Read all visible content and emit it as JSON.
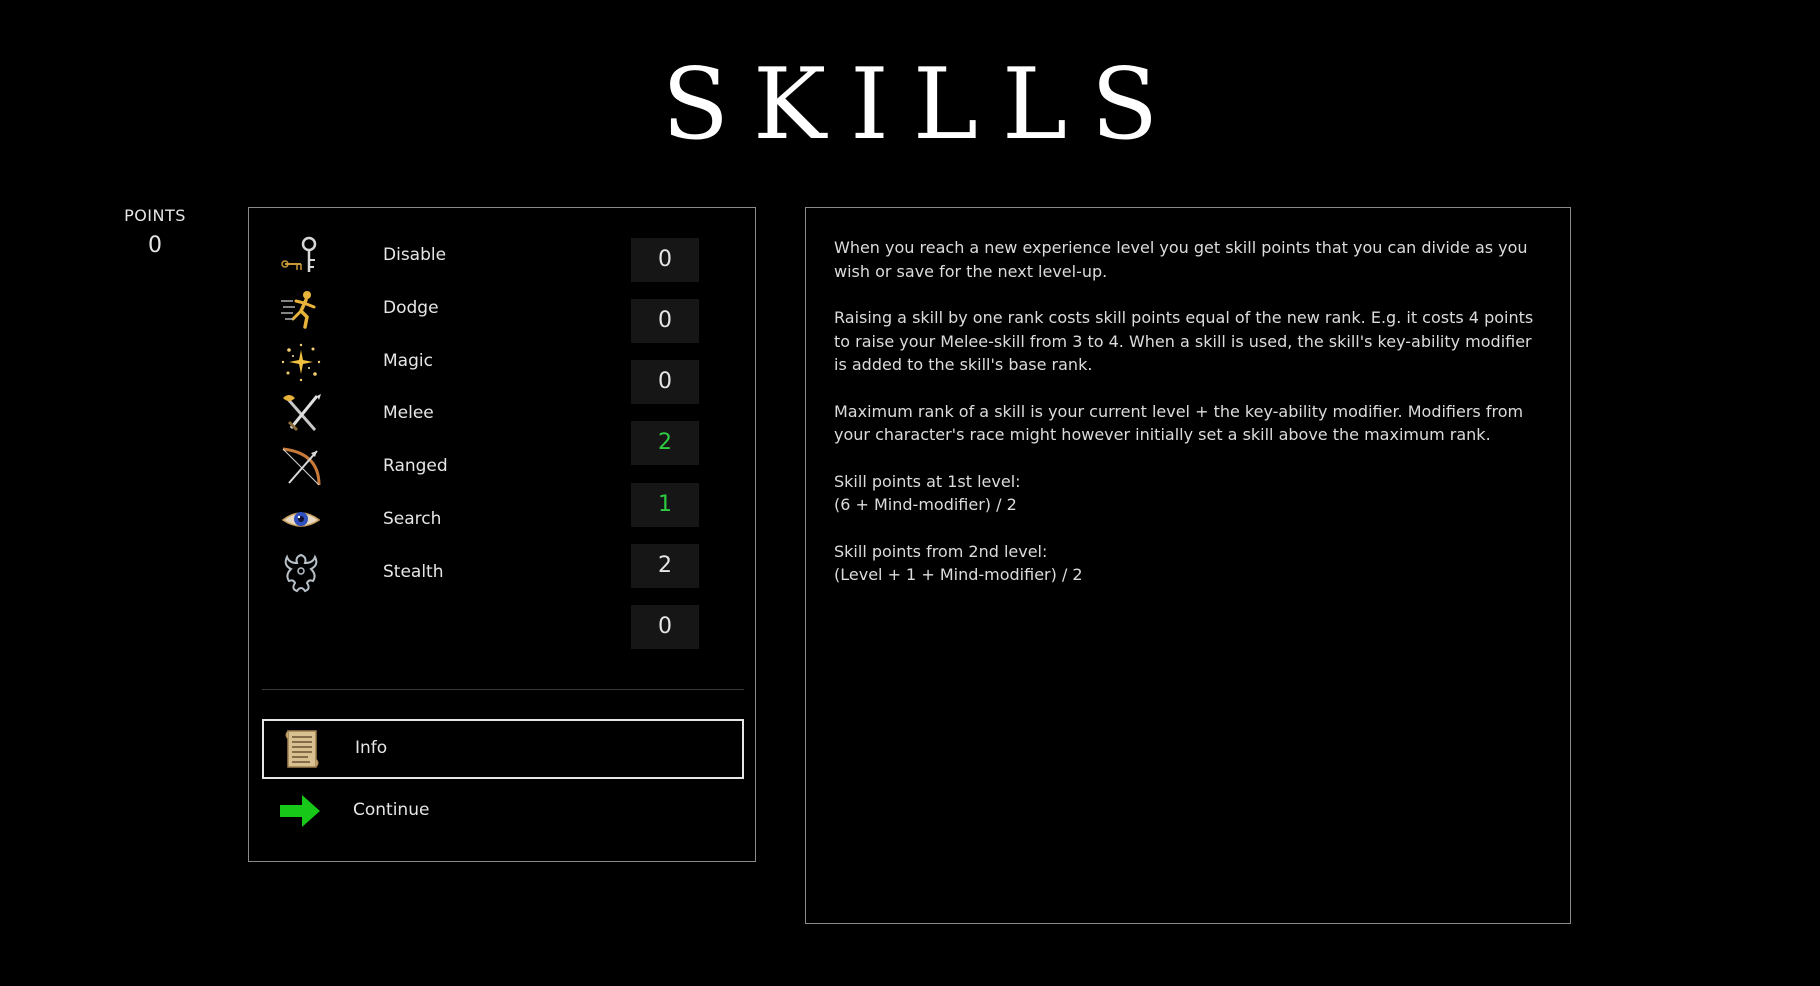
{
  "title": "SKILLS",
  "points": {
    "label": "POINTS",
    "value": "0"
  },
  "skills": [
    {
      "label": "Disable",
      "rank": "0",
      "icon": "disable-icon",
      "raised": false
    },
    {
      "label": "Dodge",
      "rank": "0",
      "icon": "dodge-icon",
      "raised": false
    },
    {
      "label": "Magic",
      "rank": "0",
      "icon": "magic-icon",
      "raised": false
    },
    {
      "label": "Melee",
      "rank": "2",
      "icon": "melee-icon",
      "raised": true
    },
    {
      "label": "Ranged",
      "rank": "1",
      "icon": "ranged-icon",
      "raised": true
    },
    {
      "label": "Search",
      "rank": "2",
      "icon": "search-icon",
      "raised": false
    },
    {
      "label": "Stealth",
      "rank": "0",
      "icon": "stealth-icon",
      "raised": false
    }
  ],
  "actions": {
    "info": {
      "label": "Info",
      "icon": "scroll-icon"
    },
    "continue": {
      "label": "Continue",
      "icon": "green-arrow-icon"
    }
  },
  "info_text": {
    "p1": "When you reach a new experience level you get skill points that you can divide as you wish or save for the next level-up.",
    "p2": "Raising a skill by one rank costs skill points equal of the new rank. E.g. it costs 4 points to raise your Melee-skill from 3 to 4. When a skill is used, the skill's key-ability modifier is added to the skill's base rank.",
    "p3": "Maximum rank of a skill is your current level + the key-ability modifier. Modifiers from your character's race might however initially set a skill above the maximum rank.",
    "p4_line1": "Skill points at 1st level:",
    "p4_line2": "(6 + Mind-modifier) / 2",
    "p5_line1": "Skill points from 2nd level:",
    "p5_line2": "(Level + 1 + Mind-modifier) / 2"
  },
  "colors": {
    "background": "#000000",
    "text": "#e6e6e6",
    "raised_rank": "#2ecc40",
    "panel_border": "#8a8a8a",
    "rank_box": "#161616"
  }
}
